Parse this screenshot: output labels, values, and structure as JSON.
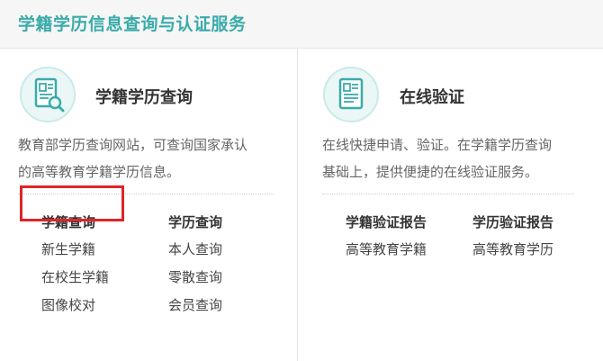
{
  "header": {
    "title": "学籍学历信息查询与认证服务"
  },
  "left": {
    "icon": "document-search-icon",
    "title": "学籍学历查询",
    "desc_line1": "教育部学历查询网站，可查询国家承认",
    "desc_line2": "的高等教育学籍学历信息。",
    "col1": {
      "head": "学籍查询",
      "items": [
        "新生学籍",
        "在校生学籍",
        "图像校对"
      ]
    },
    "col2": {
      "head": "学历查询",
      "items": [
        "本人查询",
        "零散查询",
        "会员查询"
      ]
    }
  },
  "right": {
    "icon": "document-verify-icon",
    "title": "在线验证",
    "desc_line1": "在线快捷申请、验证。在学籍学历查询",
    "desc_line2": "基础上，提供便捷的在线验证服务。",
    "col1": {
      "head": "学籍验证报告",
      "items": [
        "高等教育学籍"
      ]
    },
    "col2": {
      "head": "学历验证报告",
      "items": [
        "高等教育学历"
      ]
    }
  },
  "colors": {
    "accent": "#3aabaa",
    "highlight": "#e0242b"
  }
}
